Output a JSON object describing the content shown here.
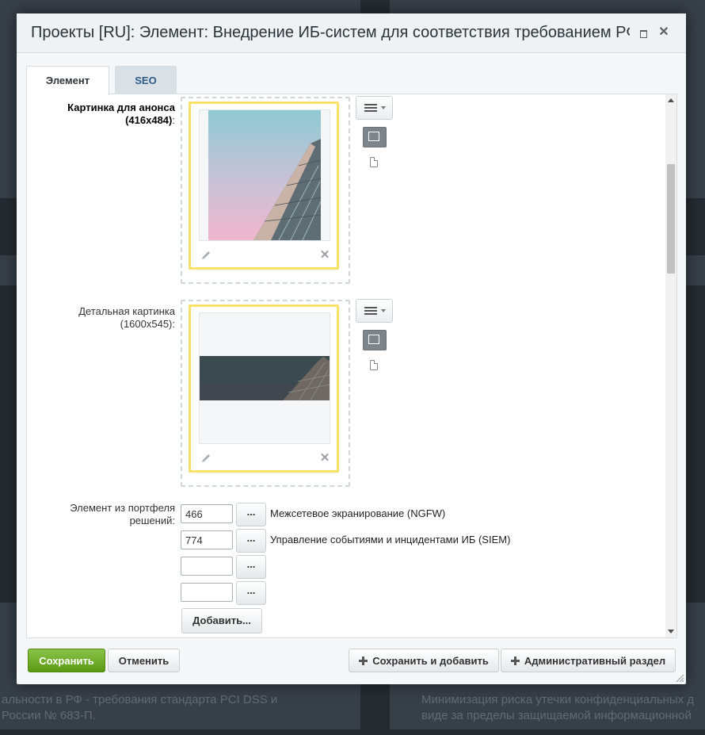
{
  "background": {
    "text_lines": [
      "альности в РФ - требования стандарта PCI DSS и",
      "России № 683-П.",
      "Минимизация риска утечки конфиденциальных д",
      "виде за пределы защищаемой информационной"
    ]
  },
  "dialog": {
    "title": "Проекты [RU]: Элемент: Внедрение ИБ-систем для соответствия требованием РФ",
    "maximize_icon": "maximize-icon",
    "close_icon": "close-icon"
  },
  "tabs": [
    {
      "label": "Элемент",
      "active": true
    },
    {
      "label": "SEO",
      "active": false
    }
  ],
  "fields": {
    "preview_image": {
      "label": "Картинка для анонса (416x484)",
      "suffix": ":"
    },
    "detail_image": {
      "label": "Детальная картинка (1600x545):"
    },
    "portfolio": {
      "label": "Элемент из портфеля решений:",
      "rows": [
        {
          "id": "466",
          "name": "Межсетевое экранирование (NGFW)"
        },
        {
          "id": "774",
          "name": "Управление событиями и инцидентами ИБ (SIEM)"
        },
        {
          "id": "",
          "name": ""
        },
        {
          "id": "",
          "name": ""
        }
      ],
      "browse_label": "...",
      "add_label": "Добавить..."
    }
  },
  "footer": {
    "save": "Сохранить",
    "cancel": "Отменить",
    "save_and_add": "Сохранить и добавить",
    "admin_section": "Административный раздел"
  },
  "colors": {
    "save_button": "#5a9a12",
    "file_card_border": "#f7e16a",
    "seo_tab_text": "#2f5a8a"
  }
}
